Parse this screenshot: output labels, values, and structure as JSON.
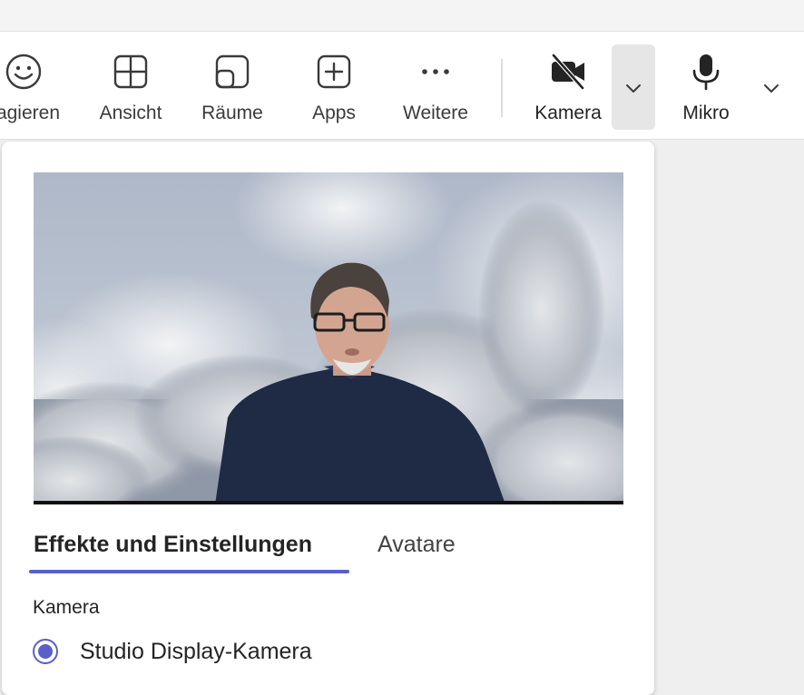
{
  "toolbar": {
    "items": [
      {
        "label": "agieren",
        "icon": "emoji-icon"
      },
      {
        "label": "Ansicht",
        "icon": "grid-view-icon"
      },
      {
        "label": "Räume",
        "icon": "rooms-icon"
      },
      {
        "label": "Apps",
        "icon": "add-app-icon"
      },
      {
        "label": "Weitere",
        "icon": "more-icon"
      },
      {
        "label": "Kamera",
        "icon": "camera-off-icon"
      },
      {
        "label": "Mikro",
        "icon": "microphone-icon"
      }
    ]
  },
  "panel": {
    "tabs": [
      {
        "label": "Effekte und Einstellungen",
        "active": true
      },
      {
        "label": "Avatare",
        "active": false
      }
    ],
    "camera_section_label": "Kamera",
    "camera_device": {
      "label": "Studio Display-Kamera",
      "selected": true
    }
  },
  "colors": {
    "accent": "#5b5fc7",
    "toolbar_bg": "#ffffff",
    "page_bg": "#efefef"
  }
}
